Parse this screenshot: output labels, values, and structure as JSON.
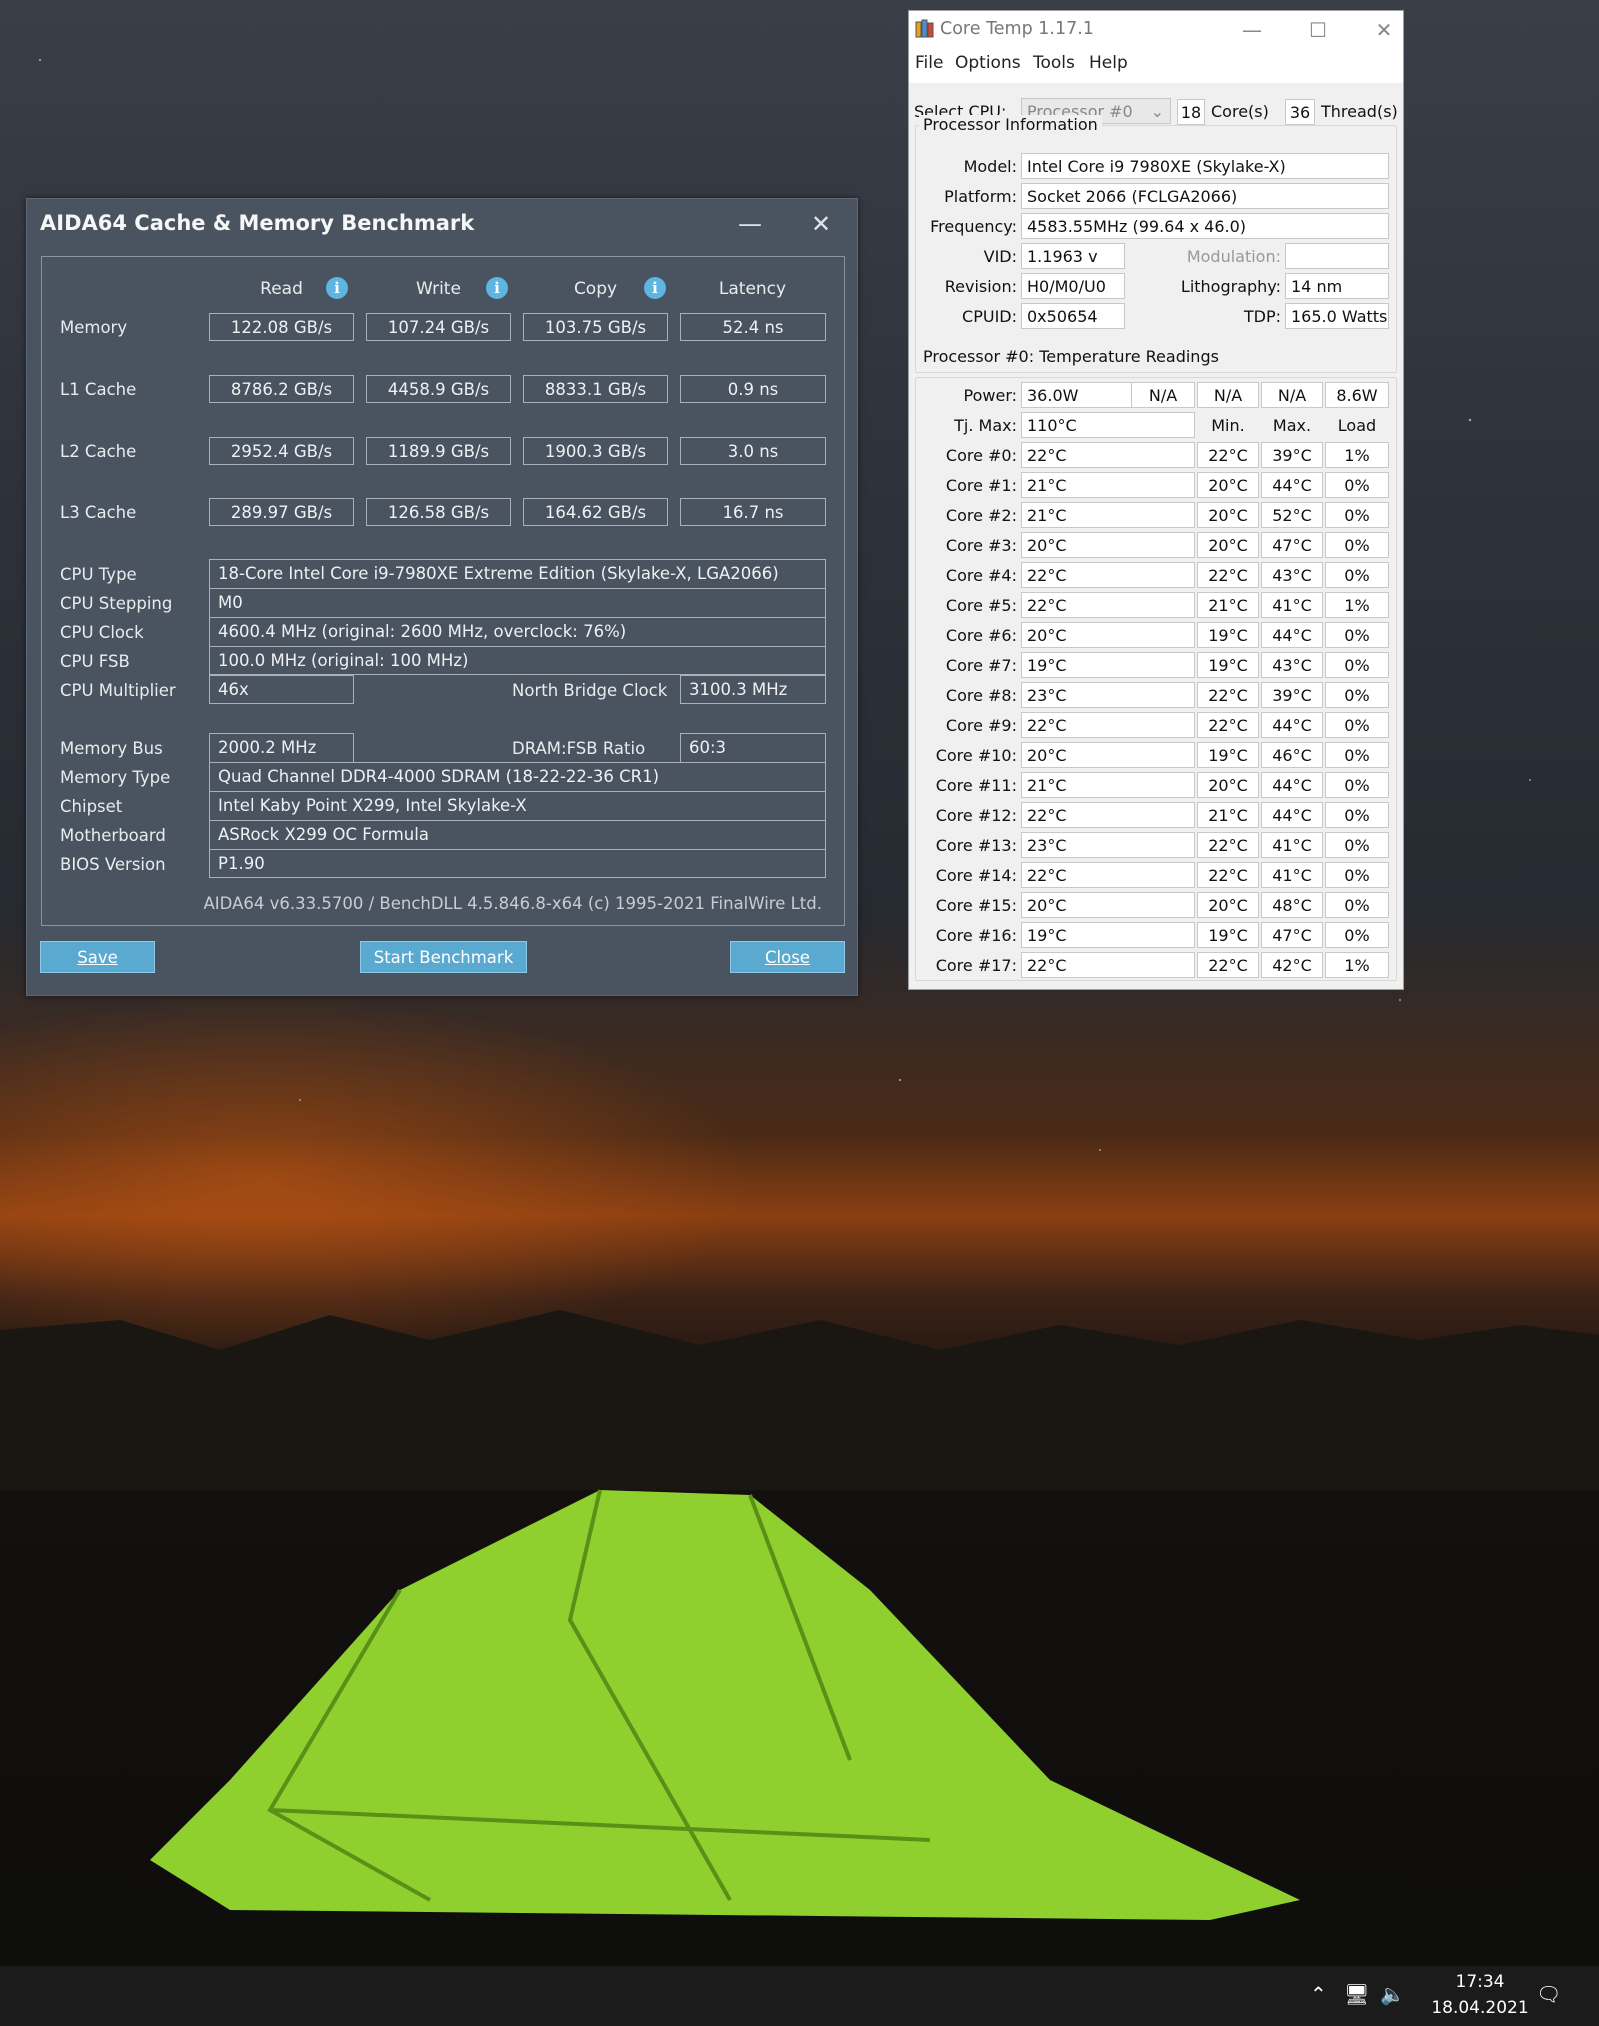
{
  "aida": {
    "title": "AIDA64 Cache & Memory Benchmark",
    "columns": [
      "Read",
      "Write",
      "Copy",
      "Latency"
    ],
    "bench_rows": [
      {
        "label": "Memory",
        "values": [
          "122.08 GB/s",
          "107.24 GB/s",
          "103.75 GB/s",
          "52.4 ns"
        ]
      },
      {
        "label": "L1 Cache",
        "values": [
          "8786.2 GB/s",
          "4458.9 GB/s",
          "8833.1 GB/s",
          "0.9 ns"
        ]
      },
      {
        "label": "L2 Cache",
        "values": [
          "2952.4 GB/s",
          "1189.9 GB/s",
          "1900.3 GB/s",
          "3.0 ns"
        ]
      },
      {
        "label": "L3 Cache",
        "values": [
          "289.97 GB/s",
          "126.58 GB/s",
          "164.62 GB/s",
          "16.7 ns"
        ]
      }
    ],
    "cpu_type_label": "CPU Type",
    "cpu_type": "18-Core Intel Core i9-7980XE Extreme Edition  (Skylake-X, LGA2066)",
    "cpu_stepping_label": "CPU Stepping",
    "cpu_stepping": "M0",
    "cpu_clock_label": "CPU Clock",
    "cpu_clock": "4600.4 MHz  (original: 2600 MHz, overclock: 76%)",
    "cpu_fsb_label": "CPU FSB",
    "cpu_fsb": "100.0 MHz  (original: 100 MHz)",
    "cpu_multiplier_label": "CPU Multiplier",
    "cpu_multiplier": "46x",
    "nb_clock_label": "North Bridge Clock",
    "nb_clock": "3100.3 MHz",
    "memory_bus_label": "Memory Bus",
    "memory_bus": "2000.2 MHz",
    "dram_ratio_label": "DRAM:FSB Ratio",
    "dram_ratio": "60:3",
    "memory_type_label": "Memory Type",
    "memory_type": "Quad Channel DDR4-4000 SDRAM  (18-22-22-36 CR1)",
    "chipset_label": "Chipset",
    "chipset": "Intel Kaby Point X299, Intel Skylake-X",
    "motherboard_label": "Motherboard",
    "motherboard": "ASRock X299 OC Formula",
    "bios_label": "BIOS Version",
    "bios": "P1.90",
    "footer": "AIDA64 v6.33.5700 / BenchDLL 4.5.846.8-x64  (c) 1995-2021 FinalWire Ltd.",
    "save_label": "Save",
    "start_label": "Start Benchmark",
    "close_label": "Close",
    "info_glyph": "i",
    "minimize_glyph": "—",
    "close_glyph": "✕"
  },
  "coretemp": {
    "title": "Core Temp 1.17.1",
    "menu": [
      "File",
      "Options",
      "Tools",
      "Help"
    ],
    "select_cpu_label": "Select CPU:",
    "processor_select": "Processor #0",
    "cores_value": "18",
    "cores_label": "Core(s)",
    "threads_value": "36",
    "threads_label": "Thread(s)",
    "proc_info_title": "Processor Information",
    "model_label": "Model:",
    "model": "Intel Core i9 7980XE (Skylake-X)",
    "platform_label": "Platform:",
    "platform": "Socket 2066 (FCLGA2066)",
    "frequency_label": "Frequency:",
    "frequency": "4583.55MHz (99.64 x 46.0)",
    "vid_label": "VID:",
    "vid": "1.1963 v",
    "modulation_label": "Modulation:",
    "modulation": "",
    "revision_label": "Revision:",
    "revision": "H0/M0/U0",
    "lithography_label": "Lithography:",
    "lithography": "14 nm",
    "cpuid_label": "CPUID:",
    "cpuid": "0x50654",
    "tdp_label": "TDP:",
    "tdp": "165.0 Watts",
    "temps_title": "Processor #0: Temperature Readings",
    "power_label": "Power:",
    "power": [
      "36.0W",
      "N/A",
      "N/A",
      "N/A",
      "8.6W"
    ],
    "tjmax_label": "Tj. Max:",
    "tjmax": "110°C",
    "min_header": "Min.",
    "max_header": "Max.",
    "load_header": "Load",
    "cores": [
      {
        "label": "Core #0:",
        "temp": "22°C",
        "min": "22°C",
        "max": "39°C",
        "load": "1%"
      },
      {
        "label": "Core #1:",
        "temp": "21°C",
        "min": "20°C",
        "max": "44°C",
        "load": "0%"
      },
      {
        "label": "Core #2:",
        "temp": "21°C",
        "min": "20°C",
        "max": "52°C",
        "load": "0%"
      },
      {
        "label": "Core #3:",
        "temp": "20°C",
        "min": "20°C",
        "max": "47°C",
        "load": "0%"
      },
      {
        "label": "Core #4:",
        "temp": "22°C",
        "min": "22°C",
        "max": "43°C",
        "load": "0%"
      },
      {
        "label": "Core #5:",
        "temp": "22°C",
        "min": "21°C",
        "max": "41°C",
        "load": "1%"
      },
      {
        "label": "Core #6:",
        "temp": "20°C",
        "min": "19°C",
        "max": "44°C",
        "load": "0%"
      },
      {
        "label": "Core #7:",
        "temp": "19°C",
        "min": "19°C",
        "max": "43°C",
        "load": "0%"
      },
      {
        "label": "Core #8:",
        "temp": "23°C",
        "min": "22°C",
        "max": "39°C",
        "load": "0%"
      },
      {
        "label": "Core #9:",
        "temp": "22°C",
        "min": "22°C",
        "max": "44°C",
        "load": "0%"
      },
      {
        "label": "Core #10:",
        "temp": "20°C",
        "min": "19°C",
        "max": "46°C",
        "load": "0%"
      },
      {
        "label": "Core #11:",
        "temp": "21°C",
        "min": "20°C",
        "max": "44°C",
        "load": "0%"
      },
      {
        "label": "Core #12:",
        "temp": "22°C",
        "min": "21°C",
        "max": "44°C",
        "load": "0%"
      },
      {
        "label": "Core #13:",
        "temp": "23°C",
        "min": "22°C",
        "max": "41°C",
        "load": "0%"
      },
      {
        "label": "Core #14:",
        "temp": "22°C",
        "min": "22°C",
        "max": "41°C",
        "load": "0%"
      },
      {
        "label": "Core #15:",
        "temp": "20°C",
        "min": "20°C",
        "max": "48°C",
        "load": "0%"
      },
      {
        "label": "Core #16:",
        "temp": "19°C",
        "min": "19°C",
        "max": "47°C",
        "load": "0%"
      },
      {
        "label": "Core #17:",
        "temp": "22°C",
        "min": "22°C",
        "max": "42°C",
        "load": "1%"
      }
    ]
  },
  "taskbar": {
    "time": "17:34",
    "date": "18.04.2021"
  },
  "colors": {
    "aida_bg": "#4a5360",
    "aida_button": "#5aa9d1",
    "info_icon": "#5fb5e2",
    "taskbar": "#1b1b1c"
  }
}
